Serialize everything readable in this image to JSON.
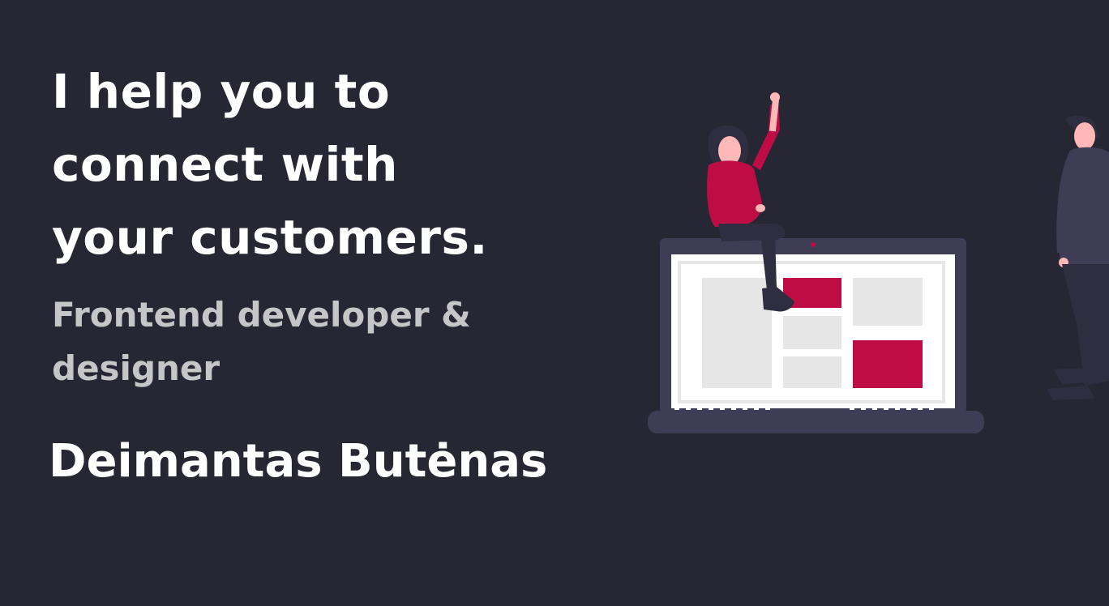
{
  "hero": {
    "headline_lines": [
      "I help you to",
      "connect with",
      "your customers."
    ],
    "subtitle_lines": [
      "Frontend developer &",
      "designer"
    ],
    "name": "Deimantas Butėnas"
  },
  "illustration": {
    "icon": "laptop-people-illustration",
    "colors": {
      "background": "#272733",
      "laptop_frame": "#3f3d56",
      "screen": "#ffffff",
      "panel": "#e6e6e6",
      "accent": "#be0d45",
      "skin": "#ffb8b8",
      "hair": "#2f2e41"
    }
  }
}
